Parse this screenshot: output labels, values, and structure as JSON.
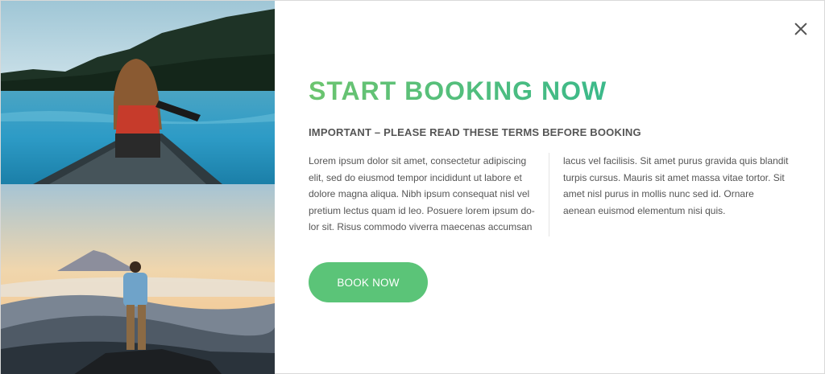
{
  "modal": {
    "title": "START BOOKING NOW",
    "subtitle": "IMPORTANT – PLEASE READ THESE TERMS BEFORE BOOKING",
    "body_left": "Lorem ipsum dolor sit amet, consectetur adipiscing elit, sed do eiusmod tempor incididunt ut labore et dolore magna aliqua. Nibh ipsum consequat nisl vel pretium lectus quam id leo. Posuere lorem ipsum do- lor sit. Risus commodo viverra maecenas accumsan",
    "body_right": "lacus vel facilisis. Sit amet purus gravida quis blandit turpis cursus. Mauris sit amet massa vitae tortor. Sit amet nisl purus in mollis nunc sed id. Ornare aenean euismod elementum nisi quis.",
    "button_label": "BOOK NOW",
    "close_icon": "close-icon"
  },
  "colors": {
    "accent": "#5bc478",
    "title_gradient_start": "#6cc46f",
    "title_gradient_end": "#3bb98a",
    "text": "#555555"
  }
}
